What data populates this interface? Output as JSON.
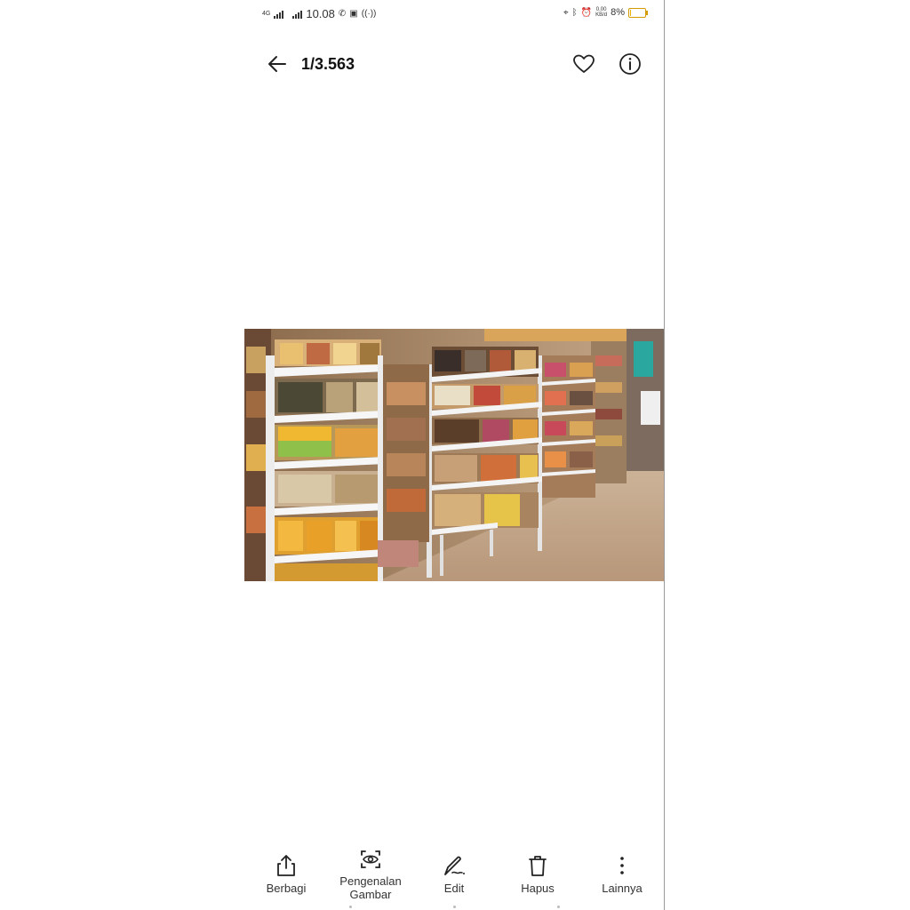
{
  "status_bar": {
    "network_type": "4G",
    "time": "10.08",
    "data_rate": "0.00",
    "data_rate_unit": "KB/d",
    "battery": "8%",
    "battery_level": 0.08
  },
  "header": {
    "counter": "1/3.563"
  },
  "photo": {
    "subject": "supermarket shelves"
  },
  "toolbar": {
    "share_label": "Berbagi",
    "recognition_label_line1": "Pengenalan",
    "recognition_label_line2": "Gambar",
    "edit_label": "Edit",
    "delete_label": "Hapus",
    "more_label": "Lainnya"
  },
  "colors": {
    "battery_outline": "#d49b00",
    "text_primary": "#111111"
  },
  "icons": {
    "back": "arrow-left-icon",
    "favorite": "heart-icon",
    "info": "info-icon",
    "share": "share-icon",
    "recognition": "image-recognition-icon",
    "edit": "pen-icon",
    "delete": "trash-icon",
    "more": "more-vertical-icon"
  }
}
